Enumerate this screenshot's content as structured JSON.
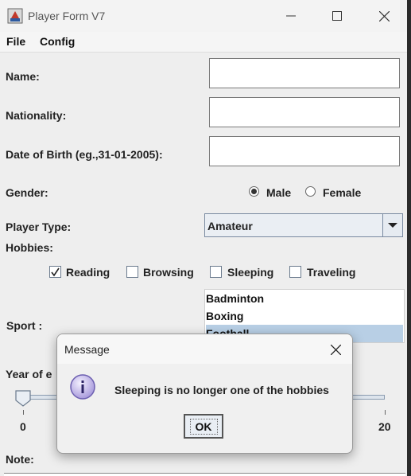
{
  "window": {
    "title": "Player Form V7"
  },
  "menu": {
    "file": "File",
    "config": "Config"
  },
  "form": {
    "name_label": "Name:",
    "nationality_label": "Nationality:",
    "dob_label": "Date of Birth (eg.,31-01-2005):",
    "gender_label": "Gender:",
    "gender_male": "Male",
    "gender_female": "Female",
    "gender_selected": "Male",
    "player_type_label": "Player Type:",
    "player_type_value": "Amateur",
    "hobbies_label": "Hobbies:",
    "hobbies": [
      {
        "label": "Reading",
        "checked": true
      },
      {
        "label": "Browsing",
        "checked": false
      },
      {
        "label": "Sleeping",
        "checked": false
      },
      {
        "label": "Traveling",
        "checked": false
      }
    ],
    "sport_label": "Sport :",
    "sports": [
      "Badminton",
      "Boxing",
      "Football"
    ],
    "sport_selected": "Football",
    "year_label": "Year of e",
    "slider_min": "0",
    "slider_max": "20",
    "slider_value": 0,
    "note_label": "Note:"
  },
  "dialog": {
    "title": "Message",
    "message": "Sleeping is no longer one of the hobbies",
    "ok_label": "OK"
  },
  "colors": {
    "selection": "#b8cfe5",
    "window_bg": "#eeeeee",
    "dialog_bg": "#f0f0f0"
  }
}
